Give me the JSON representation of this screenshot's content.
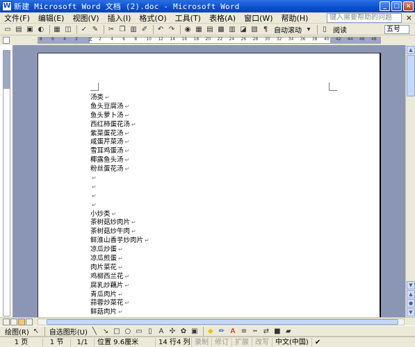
{
  "window": {
    "title": "新建 Microsoft Word 文档 (2).doc - Microsoft Word",
    "app_icon": "W",
    "minimize": "_",
    "maximize": "□",
    "close": "×"
  },
  "menu": {
    "items": [
      "文件(F)",
      "编辑(E)",
      "视图(V)",
      "插入(I)",
      "格式(O)",
      "工具(T)",
      "表格(A)",
      "窗口(W)",
      "帮助(H)"
    ],
    "help_placeholder": "键入需要帮助的问题",
    "close_doc": "×"
  },
  "toolbar": {
    "zoom_label": "自动滚动",
    "reading_label": "阅读",
    "font_size": "五号"
  },
  "ruler": {
    "ticks": [
      "8",
      "6",
      "4",
      "2",
      "",
      "2",
      "4",
      "6",
      "8",
      "10",
      "12",
      "14",
      "16",
      "18",
      "20",
      "22",
      "24",
      "26",
      "28",
      "30",
      "32",
      "34",
      "36",
      "38",
      "40",
      "42",
      "44",
      "46",
      "48"
    ]
  },
  "document": {
    "pilcrow": "↵",
    "lines": [
      "  汤类",
      "鱼头豆腐汤",
      "鱼头萝卜汤",
      "西红柿蛋花汤",
      "紫菜蛋花汤",
      "咸蛋芹菜汤",
      "雪耳鸡蛋汤",
      "椰露鱼头汤",
      "粉丝蛋花汤",
      "",
      "",
      "",
      "",
      "小炒类",
      "茶树菇炒肉片",
      "茶树菇炒牛肉",
      "鲜淮山香芋炒肉片",
      "凉瓜炒蛋",
      "凉瓜煎蛋",
      "肉片菜花",
      "鸡柳西兰花",
      "腐乳炒藕片",
      "青瓜肉片",
      "蒜蓉炒菜花",
      "鲜菇肉片"
    ]
  },
  "drawbar": {
    "draw_label": "绘图(R)",
    "autoshape_label": "自选图形(U)"
  },
  "status": {
    "page": "1 页",
    "section": "1 节",
    "page_of": "1/1",
    "position": "位置 9.6厘米",
    "line": "14 行",
    "column": "4 列",
    "rec": "录制",
    "trk": "修订",
    "ext": "扩展",
    "ovr": "改写",
    "language": "中文(中国)"
  }
}
